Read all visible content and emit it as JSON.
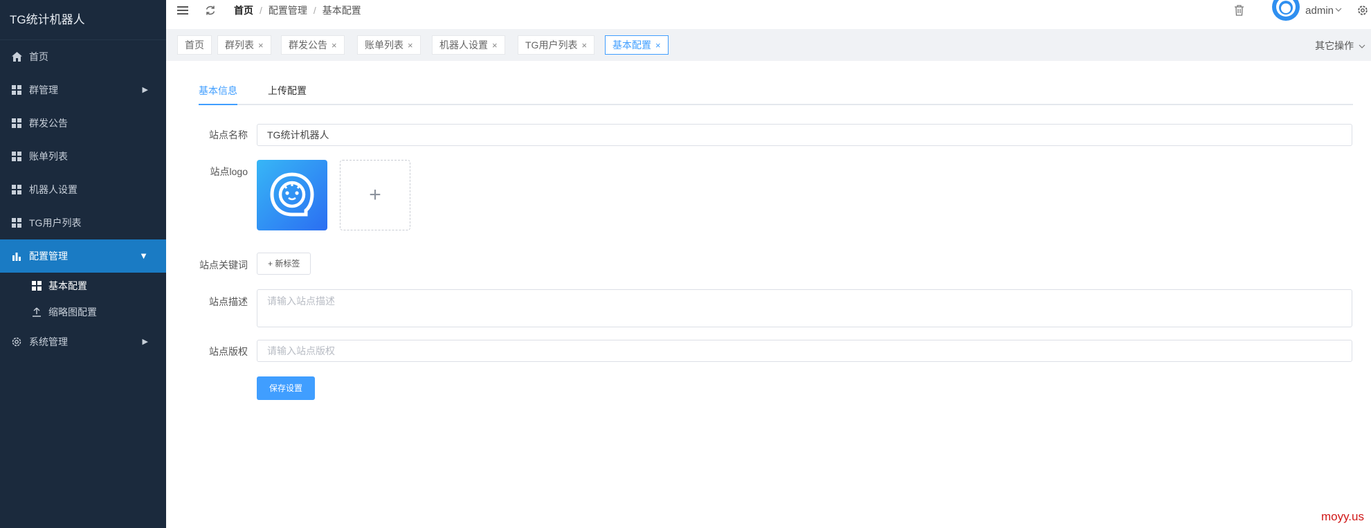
{
  "app": {
    "title": "TG统计机器人"
  },
  "sidebar": {
    "items": [
      {
        "label": "首页",
        "icon": "home-icon"
      },
      {
        "label": "群管理",
        "icon": "grid-icon"
      },
      {
        "label": "群发公告",
        "icon": "grid-icon"
      },
      {
        "label": "账单列表",
        "icon": "grid-icon"
      },
      {
        "label": "机器人设置",
        "icon": "grid-icon"
      },
      {
        "label": "TG用户列表",
        "icon": "grid-icon"
      },
      {
        "label": "配置管理",
        "icon": "bar-chart-icon"
      },
      {
        "label": "系统管理",
        "icon": "gear-icon"
      }
    ],
    "submenu": [
      {
        "label": "基本配置",
        "icon": "grid-icon"
      },
      {
        "label": "缩略图配置",
        "icon": "upload-icon"
      }
    ]
  },
  "header": {
    "breadcrumb": [
      "首页",
      "配置管理",
      "基本配置"
    ],
    "breadcrumb_sep": "/",
    "username": "admin"
  },
  "tags": {
    "items": [
      "首页",
      "群列表",
      "群发公告",
      "账单列表",
      "机器人设置",
      "TG用户列表",
      "基本配置"
    ],
    "close": "×",
    "other_ops": "其它操作"
  },
  "form": {
    "tabs": [
      "基本信息",
      "上传配置"
    ],
    "site_name_label": "站点名称",
    "site_name_value": "TG统计机器人",
    "site_logo_label": "站点logo",
    "upload_plus": "+",
    "keywords_label": "站点关键词",
    "new_tag_button": "+ 新标签",
    "description_label": "站点描述",
    "description_placeholder": "请输入站点描述",
    "copyright_label": "站点版权",
    "copyright_placeholder": "请输入站点版权",
    "save_button": "保存设置"
  },
  "watermark": "moyy.us",
  "colors": {
    "sidebar_bg": "#1b2a3d",
    "sidebar_active": "#1a7bc4",
    "primary": "#409eff"
  }
}
